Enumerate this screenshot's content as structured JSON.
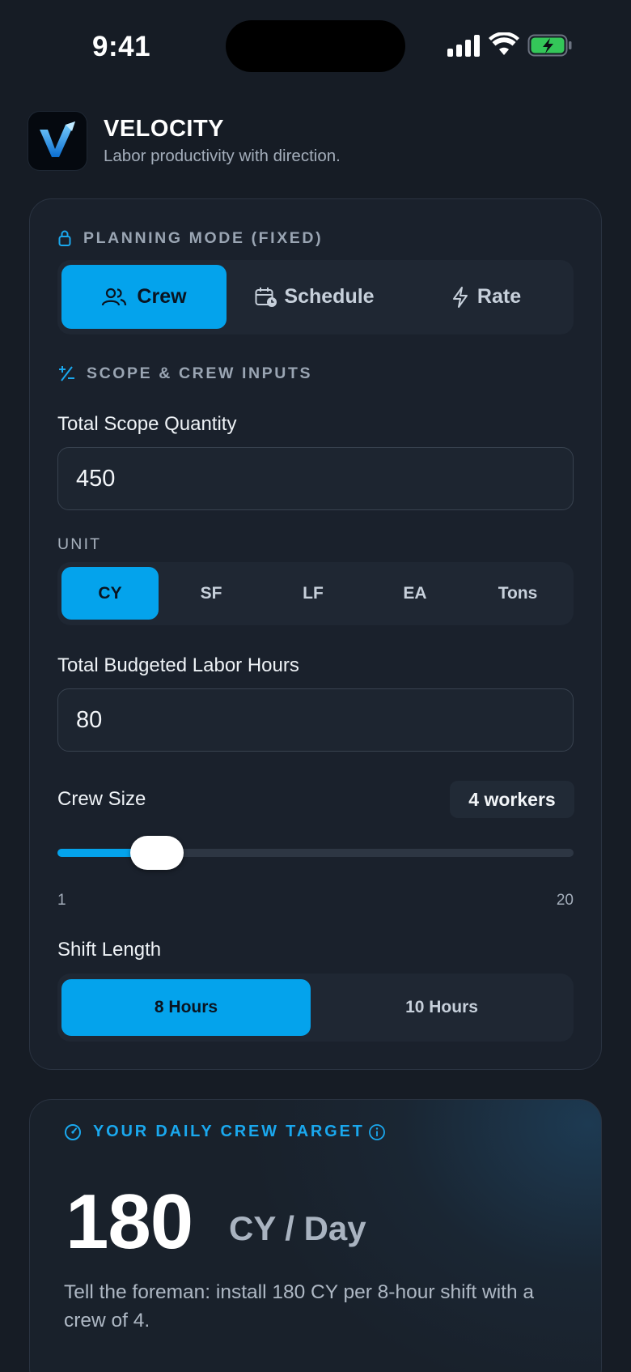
{
  "status_bar": {
    "time": "9:41"
  },
  "header": {
    "logo_letter": "V",
    "title": "VELOCITY",
    "subtitle": "Labor productivity with direction."
  },
  "planning_mode": {
    "label": "PLANNING MODE (FIXED)",
    "options": [
      {
        "label": "Crew",
        "icon": "users-icon",
        "active": true
      },
      {
        "label": "Schedule",
        "icon": "calendar-clock-icon",
        "active": false
      },
      {
        "label": "Rate",
        "icon": "lightning-icon",
        "active": false
      }
    ]
  },
  "scope": {
    "section_label": "SCOPE & CREW INPUTS",
    "quantity_label": "Total Scope Quantity",
    "quantity_value": "450",
    "unit_label": "UNIT",
    "units": [
      "CY",
      "SF",
      "LF",
      "EA",
      "Tons"
    ],
    "selected_unit": "CY",
    "hours_label": "Total Budgeted Labor Hours",
    "hours_value": "80",
    "crew_label": "Crew Size",
    "crew_badge": "4 workers",
    "crew_value": 4,
    "crew_min": "1",
    "crew_max": "20",
    "shift_label": "Shift Length",
    "shift_options": [
      "8 Hours",
      "10 Hours"
    ],
    "selected_shift": "8 Hours"
  },
  "target": {
    "label": "YOUR DAILY CREW TARGET",
    "value": "180",
    "unit": "CY / Day",
    "instruction": "Tell the foreman: install 180 CY per 8-hour shift with a crew of 4."
  },
  "colors": {
    "background": "#161c25",
    "card": "#1a212c",
    "accent": "#04a3ec",
    "muted_text": "#9aa5b3"
  }
}
